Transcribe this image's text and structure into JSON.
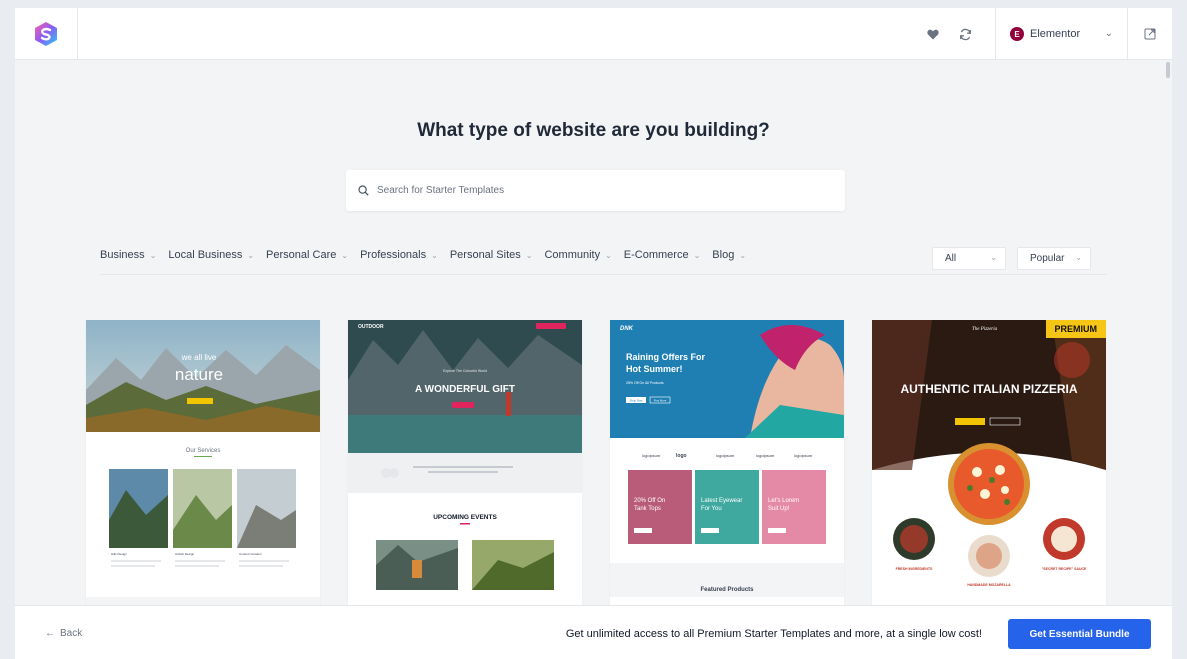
{
  "header": {
    "builder_label": "Elementor",
    "builder_badge": "E",
    "icons": [
      "heart-icon",
      "sync-icon",
      "external-link-icon"
    ]
  },
  "hero": {
    "title": "What type of website are you building?",
    "search_placeholder": "Search for Starter Templates"
  },
  "categories": [
    {
      "label": "Business"
    },
    {
      "label": "Local Business"
    },
    {
      "label": "Personal Care"
    },
    {
      "label": "Professionals"
    },
    {
      "label": "Personal Sites"
    },
    {
      "label": "Community"
    },
    {
      "label": "E-Commerce"
    },
    {
      "label": "Blog"
    }
  ],
  "filters": {
    "type": "All",
    "sort": "Popular"
  },
  "cards": [
    {
      "hero_line1": "we all live",
      "hero_line2": "nature",
      "section_title": "Our Services",
      "tile_captions": [
        "Hills Design",
        "Artistic Design",
        "Content Creation"
      ]
    },
    {
      "brand": "OUTDOOR",
      "hero_kicker": "Explore The Colourful World",
      "hero_title": "A WONDERFUL GIFT",
      "section_title": "UPCOMING EVENTS"
    },
    {
      "brand": "DNK",
      "hero_title_1": "Raining Offers For",
      "hero_title_2": "Hot Summer!",
      "hero_sub": "25% Off On All Products",
      "buttons": [
        "Shop Now",
        "Find More"
      ],
      "logos": [
        "logoipsum",
        "logo",
        "logoipsum",
        "logoipsum",
        "logoipsum"
      ],
      "promos": [
        {
          "line1": "20% Off On",
          "line2": "Tank Tops"
        },
        {
          "line1": "Latest Eyewear",
          "line2": "For You"
        },
        {
          "line1": "Let's Lorem",
          "line2": "Suit Up!"
        }
      ],
      "section_title": "Featured Products"
    },
    {
      "brand": "The Pizzeria",
      "badge": "PREMIUM",
      "hero_title": "AUTHENTIC ITALIAN PIZZERIA",
      "features": [
        "FRESH INGREDIENTS",
        "HANDMADE MOZARELLA",
        "\"SECRET RECIPE\" SAUCE"
      ]
    }
  ],
  "footer": {
    "back_label": "Back",
    "cta_text": "Get unlimited access to all Premium Starter Templates and more, at a single low cost!",
    "cta_button": "Get Essential Bundle"
  },
  "colors": {
    "accent": "#2563eb",
    "premium": "#f7c515",
    "background": "#f3f4f6"
  }
}
